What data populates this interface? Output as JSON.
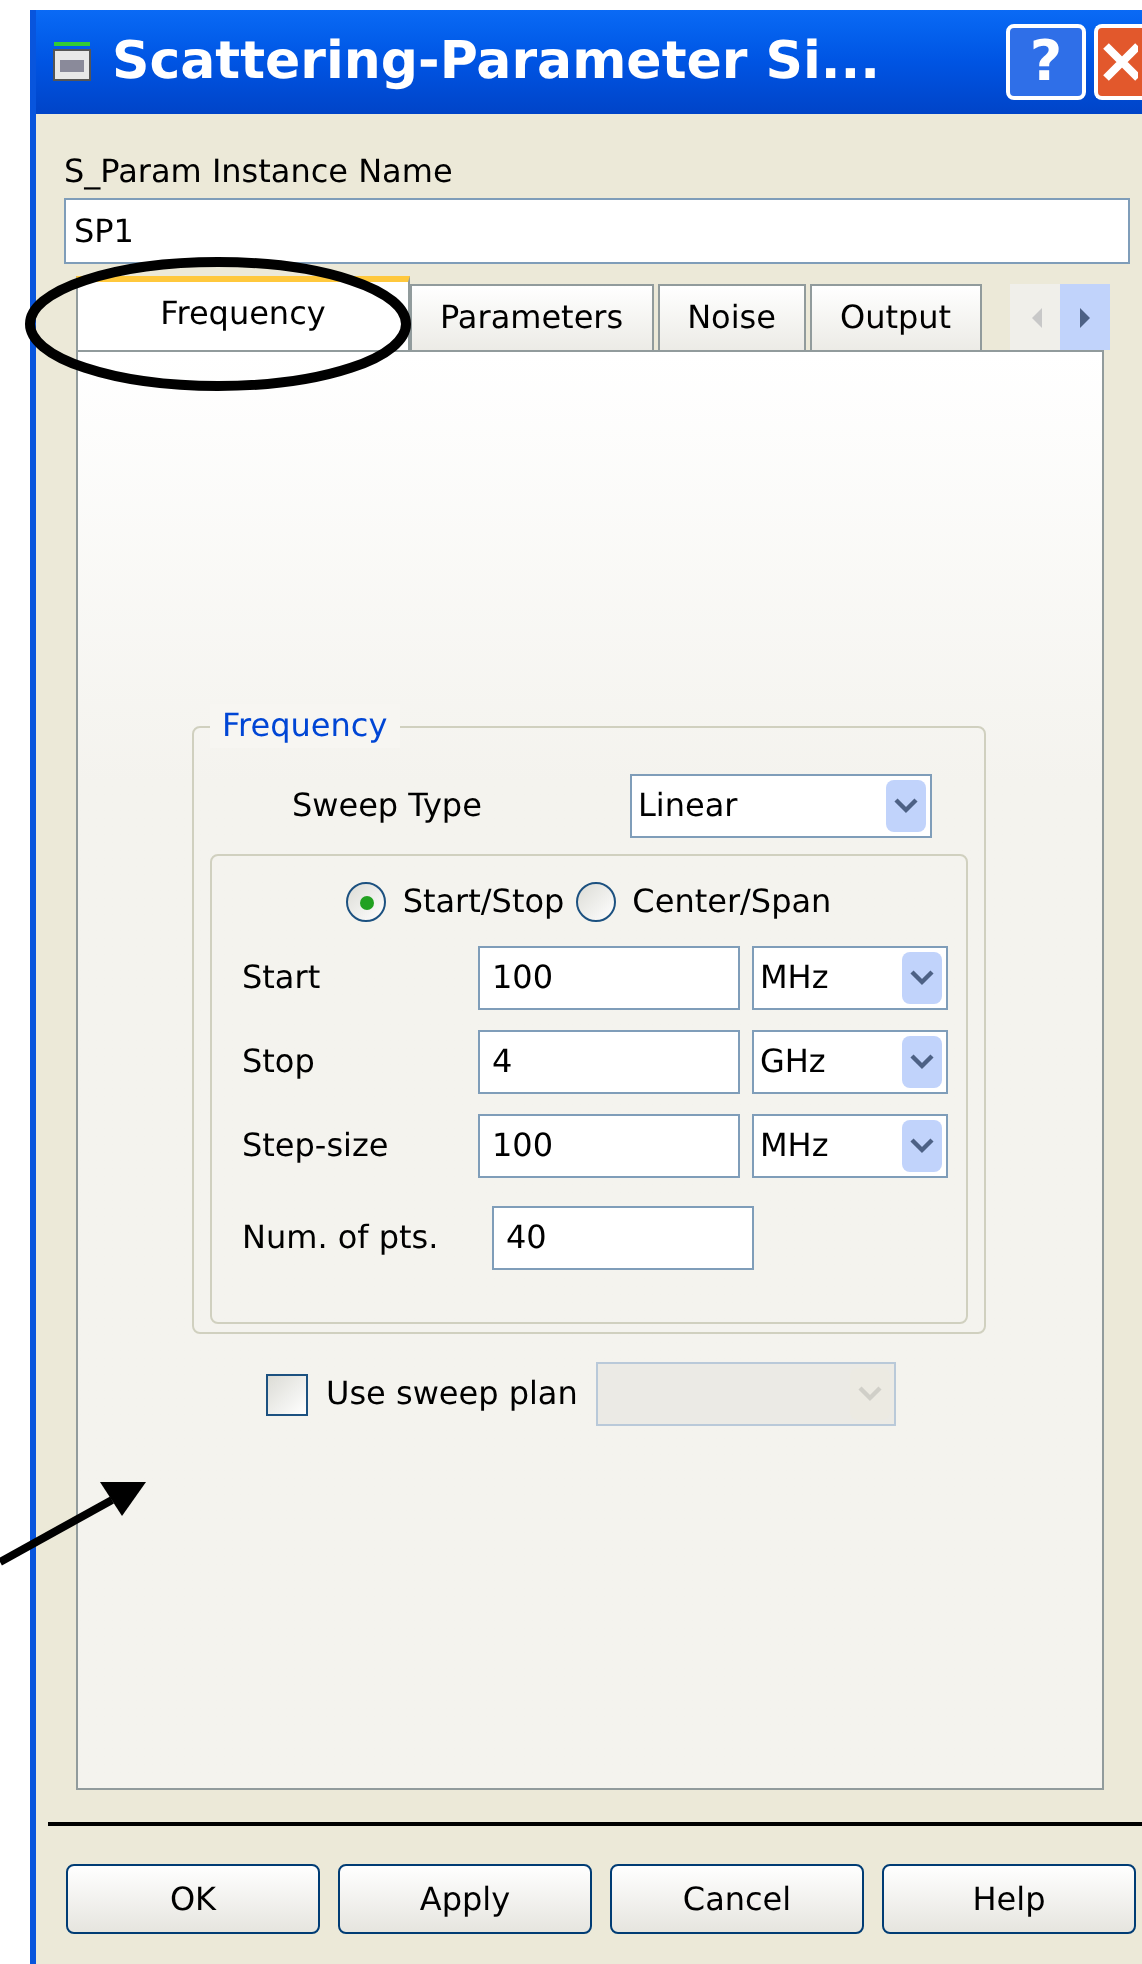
{
  "window": {
    "title": "Scattering-Parameter Si...",
    "help_button": "?"
  },
  "instance_name": {
    "label": "S_Param Instance Name",
    "value": "SP1"
  },
  "tabs": [
    {
      "label": "Frequency",
      "selected": true
    },
    {
      "label": "Parameters",
      "selected": false
    },
    {
      "label": "Noise",
      "selected": false
    },
    {
      "label": "Output",
      "selected": false
    }
  ],
  "frequency_group": {
    "legend": "Frequency",
    "sweep_type": {
      "label": "Sweep Type",
      "value": "Linear"
    },
    "sweep_modes": [
      {
        "label": "Start/Stop",
        "selected": true
      },
      {
        "label": "Center/Span",
        "selected": false
      }
    ],
    "rows": [
      {
        "label": "Start",
        "value": "100",
        "unit": "MHz"
      },
      {
        "label": "Stop",
        "value": "4",
        "unit": "GHz"
      },
      {
        "label": "Step-size",
        "value": "100",
        "unit": "MHz"
      }
    ],
    "points": {
      "label": "Num. of pts.",
      "value": "40"
    }
  },
  "sweep_plan": {
    "label": "Use sweep plan",
    "checked": false
  },
  "buttons": [
    "OK",
    "Apply",
    "Cancel",
    "Help"
  ]
}
